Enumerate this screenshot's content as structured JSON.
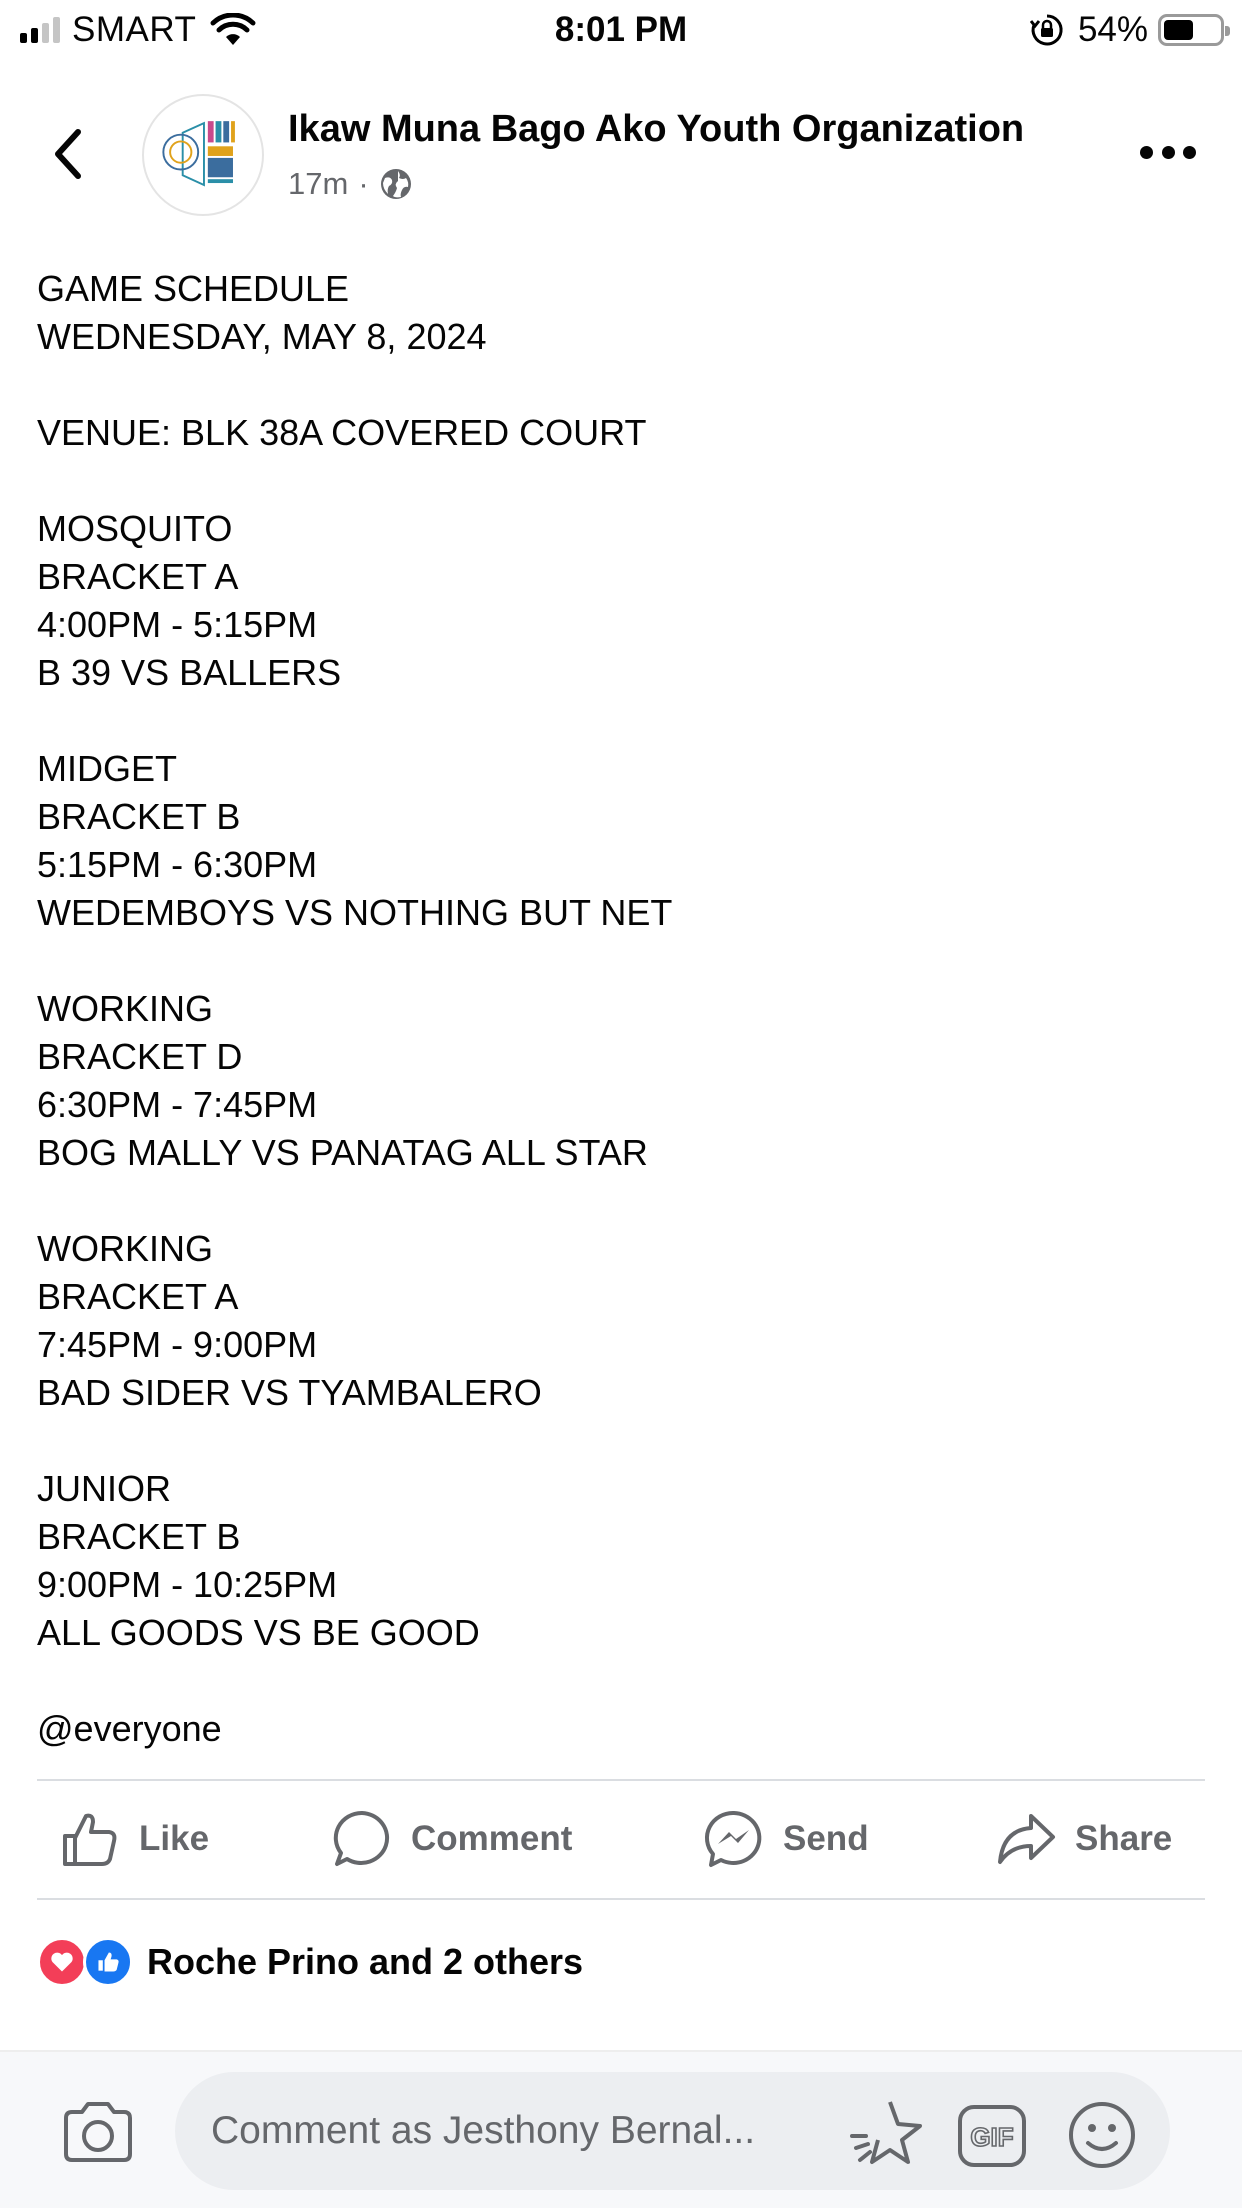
{
  "status_bar": {
    "carrier": "SMART",
    "time": "8:01 PM",
    "battery_percent": "54%",
    "battery_level": 0.54,
    "signal_bars_active": 2,
    "signal_bars_total": 4
  },
  "post": {
    "author": "Ikaw Muna Bago Ako Youth Organization",
    "timestamp": "17m",
    "separator": "·",
    "audience_icon": "globe-icon",
    "lines": [
      "GAME SCHEDULE",
      "WEDNESDAY, MAY 8, 2024",
      "",
      "VENUE: BLK 38A COVERED COURT",
      "",
      "MOSQUITO",
      "BRACKET A",
      "4:00PM - 5:15PM",
      "B 39 VS BALLERS",
      "",
      "MIDGET",
      "BRACKET B",
      "5:15PM - 6:30PM",
      "WEDEMBOYS VS NOTHING BUT NET",
      "",
      "WORKING",
      "BRACKET D",
      "6:30PM - 7:45PM",
      "BOG MALLY VS PANATAG ALL STAR",
      "",
      "WORKING",
      "BRACKET A",
      "7:45PM - 9:00PM",
      "BAD SIDER VS TYAMBALERO",
      "",
      "JUNIOR",
      "BRACKET B",
      "9:00PM - 10:25PM",
      "ALL GOODS VS BE GOOD",
      "",
      "@everyone"
    ]
  },
  "actions": {
    "like": "Like",
    "comment": "Comment",
    "send": "Send",
    "share": "Share"
  },
  "reactions": {
    "text": "Roche Prino and 2 others",
    "types": [
      "love-icon",
      "like-icon"
    ]
  },
  "comment_bar": {
    "placeholder": "Comment as Jesthony Bernal...",
    "gif_label": "GIF"
  },
  "colors": {
    "text_primary": "#050505",
    "text_secondary": "#65676b",
    "like_blue": "#1877f2",
    "love_red": "#f33e58",
    "divider": "#dadde1"
  }
}
